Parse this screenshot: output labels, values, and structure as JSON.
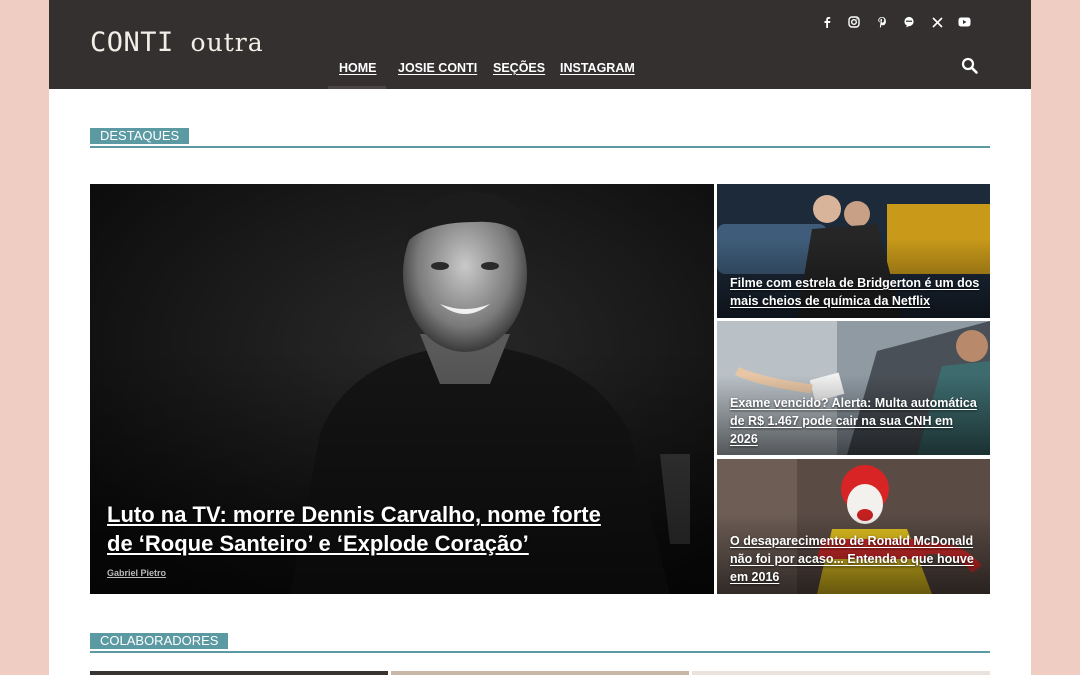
{
  "header": {
    "logo_main": "CONTI",
    "logo_sub": "outra",
    "nav": [
      {
        "label": "HOME"
      },
      {
        "label": "JOSIE CONTI"
      },
      {
        "label": "SEÇÕES"
      },
      {
        "label": "INSTAGRAM"
      }
    ],
    "social_icons": [
      "facebook-icon",
      "instagram-icon",
      "pinterest-icon",
      "chat-icon",
      "x-icon",
      "youtube-icon"
    ]
  },
  "sections": {
    "featured": "DESTAQUES",
    "contributors": "COLABORADORES"
  },
  "featured": {
    "main": {
      "title": "Luto na TV: morre Dennis Carvalho, nome forte de ‘Roque Santeiro’ e ‘Explode Coração’",
      "author": "Gabriel Pietro"
    },
    "side": [
      {
        "title": "Filme com estrela de Bridgerton é um dos mais cheios de química da Netflix"
      },
      {
        "title": "Exame vencido? Alerta: Multa automática de R$ 1.467 pode cair na sua CNH em 2026"
      },
      {
        "title": "O desaparecimento de Ronald McDonald não foi por acaso... Entenda o que houve em 2016"
      }
    ]
  },
  "colors": {
    "background": "#efcdc2",
    "header": "#343030",
    "accent": "#5b9aa3"
  }
}
